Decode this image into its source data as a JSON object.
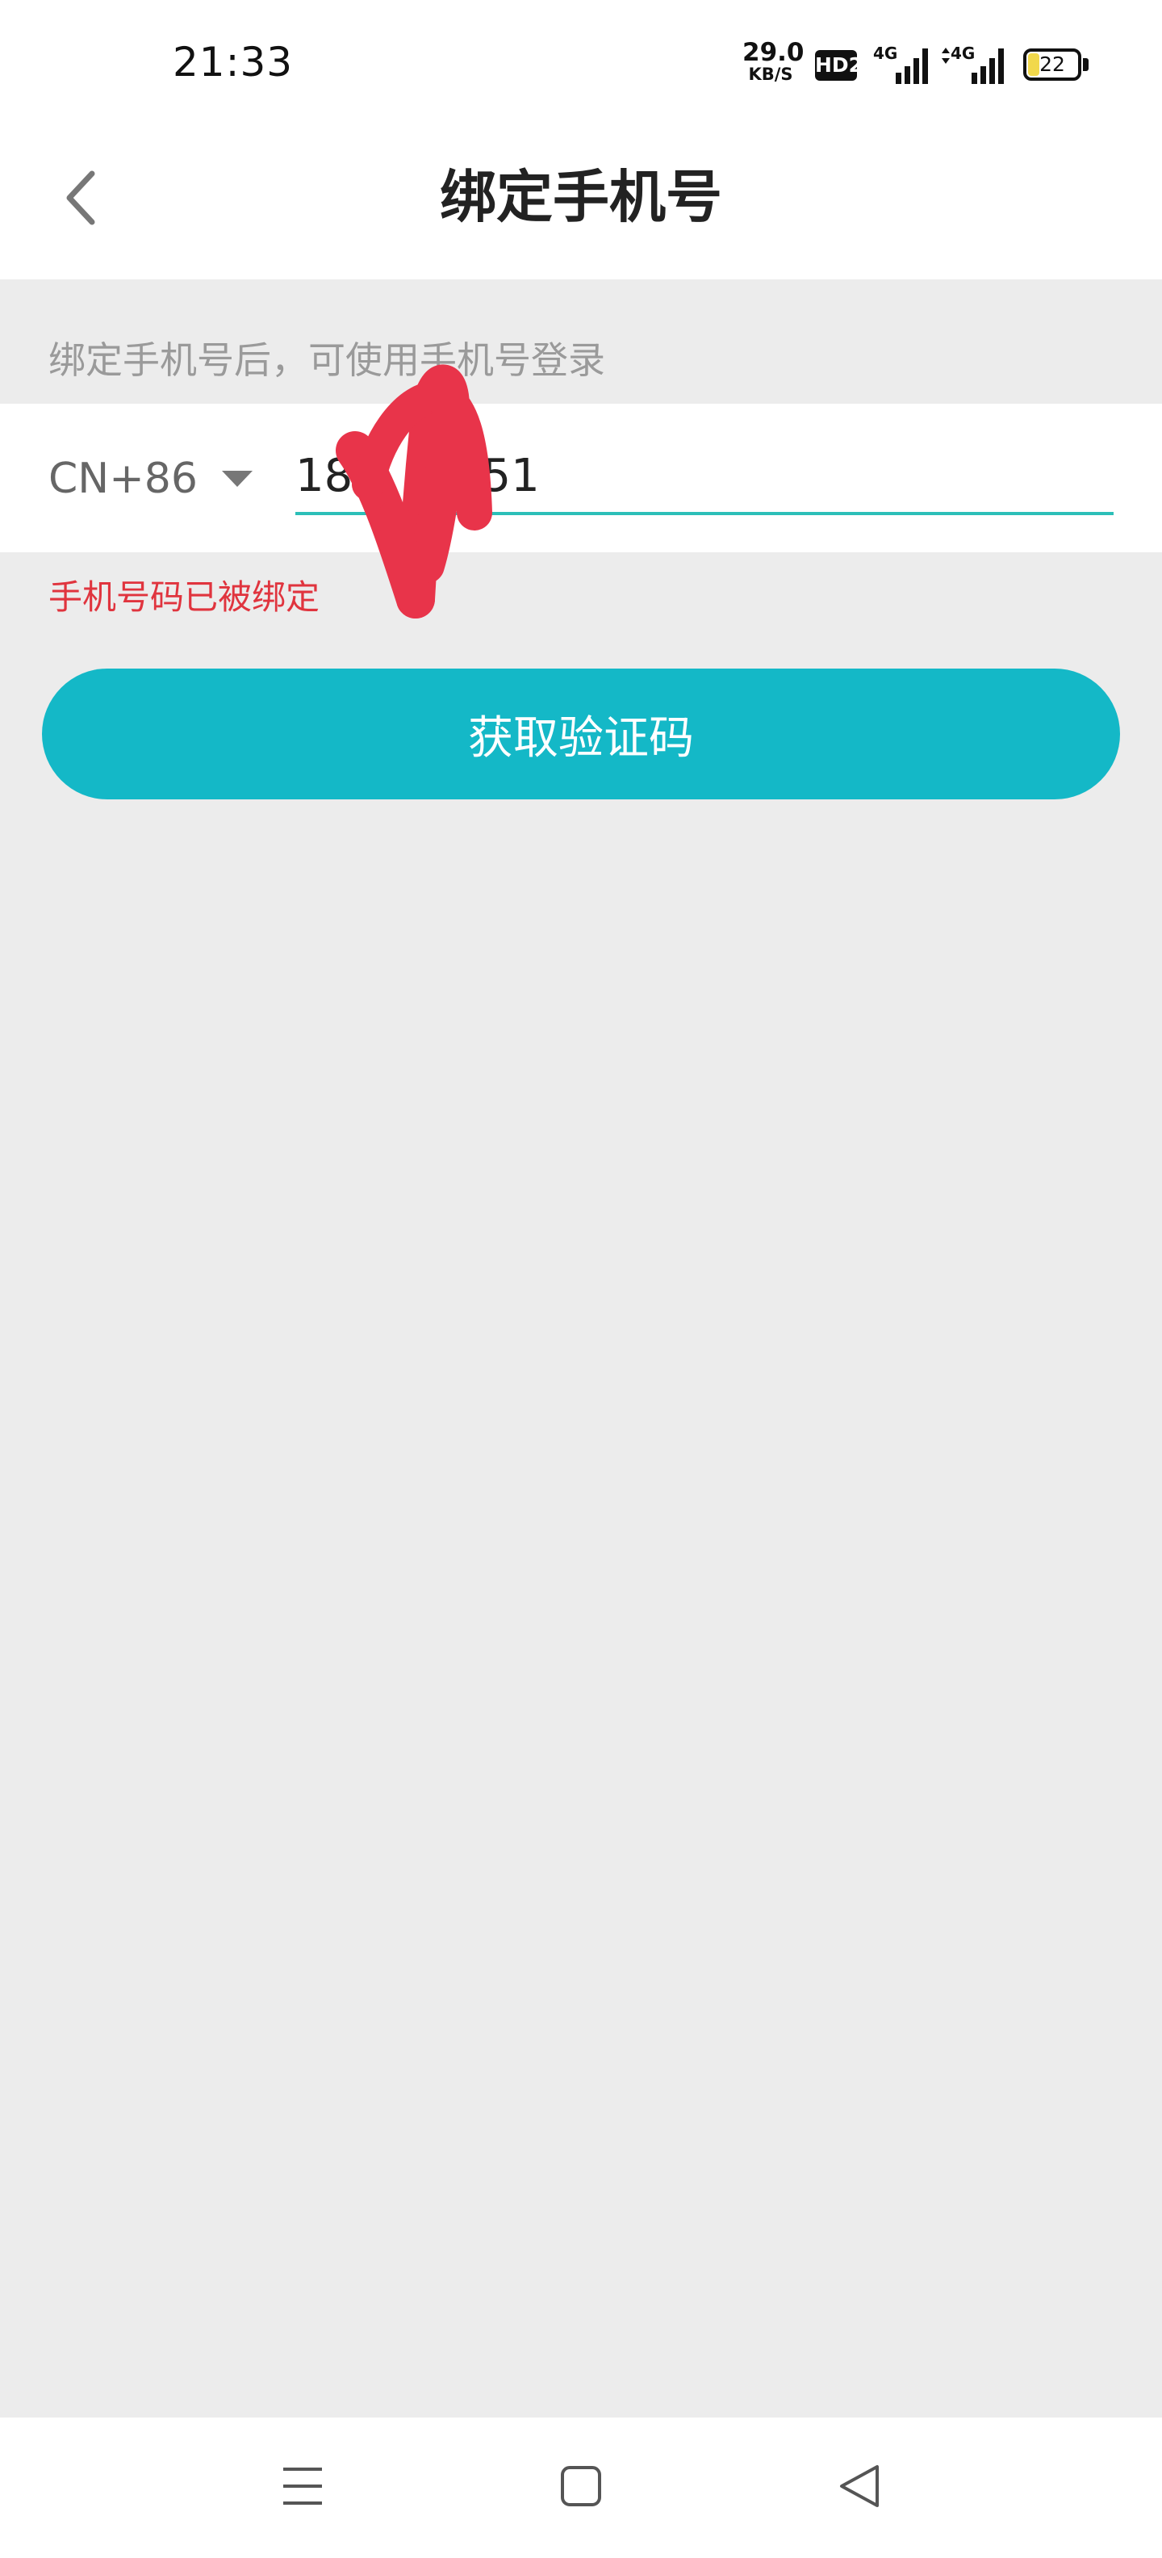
{
  "status_bar": {
    "time": "21:33",
    "net_speed_value": "29.0",
    "net_speed_unit": "KB/S",
    "hd_badge": "HD2",
    "signal_1_label": "4G",
    "signal_2_label": "4G",
    "battery_percent": "22"
  },
  "header": {
    "title": "绑定手机号",
    "back_icon": "chevron-left-icon"
  },
  "hint": "绑定手机号后，可使用手机号登录",
  "phone": {
    "country_code": "CN+86",
    "dropdown_icon": "caret-down-icon",
    "value": "18     5551"
  },
  "error_message": "手机号码已被绑定",
  "verify_button": "获取验证码",
  "nav_bar": {
    "menu_icon": "menu-icon",
    "home_icon": "square-home-icon",
    "back_icon": "triangle-back-icon"
  },
  "colors": {
    "accent": "#14b8c7",
    "underline": "#2cbfb8",
    "error": "#e0343e",
    "background": "#ececec",
    "scribble": "#e8344a"
  }
}
